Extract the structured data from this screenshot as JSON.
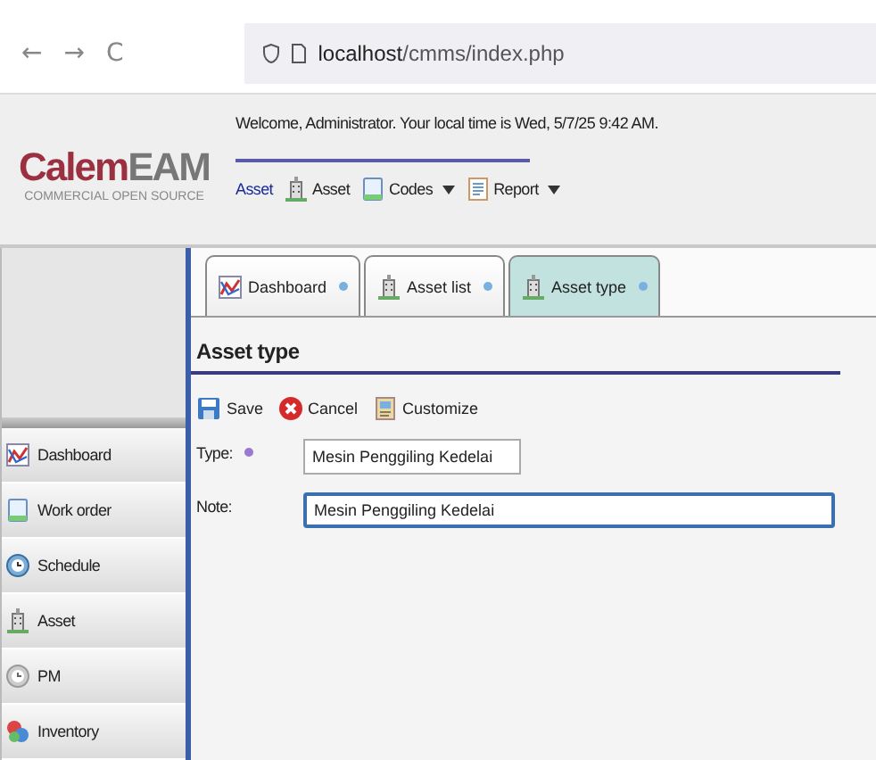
{
  "browser": {
    "back": "←",
    "forward": "→",
    "reload": "C",
    "url_host": "localhost",
    "url_path": "/cmms/index.php"
  },
  "header": {
    "logo_primary": "Calem",
    "logo_secondary": "EAM",
    "tagline": "COMMERCIAL OPEN SOURCE",
    "welcome": "Welcome, Administrator. Your local time is Wed, 5/7/25 9:42 AM.",
    "menu": [
      {
        "label": "Asset",
        "kind": "none",
        "dropdown": false
      },
      {
        "label": "Asset",
        "kind": "building",
        "dropdown": false
      },
      {
        "label": "Codes",
        "kind": "document",
        "dropdown": true
      },
      {
        "label": "Report",
        "kind": "report",
        "dropdown": true
      }
    ]
  },
  "sidebar": {
    "items": [
      {
        "label": "Dashboard",
        "kind": "chart"
      },
      {
        "label": "Work order",
        "kind": "document"
      },
      {
        "label": "Schedule",
        "kind": "clock"
      },
      {
        "label": "Asset",
        "kind": "building"
      },
      {
        "label": "PM",
        "kind": "clockgrey"
      },
      {
        "label": "Inventory",
        "kind": "inventory"
      }
    ]
  },
  "tabs": [
    {
      "label": "Dashboard",
      "kind": "chart",
      "selected": false
    },
    {
      "label": "Asset list",
      "kind": "building",
      "selected": false
    },
    {
      "label": "Asset type",
      "kind": "building",
      "selected": true
    }
  ],
  "form": {
    "title": "Asset type",
    "toolbar": [
      {
        "label": "Save",
        "kind": "save"
      },
      {
        "label": "Cancel",
        "kind": "cancel"
      },
      {
        "label": "Customize",
        "kind": "customize"
      }
    ],
    "fields": [
      {
        "label": "Type:",
        "required": true,
        "value": "Mesin Penggiling Kedelai",
        "focused": false
      },
      {
        "label": "Note:",
        "required": false,
        "value": "Mesin Penggiling Kedelai",
        "focused": true
      }
    ]
  }
}
